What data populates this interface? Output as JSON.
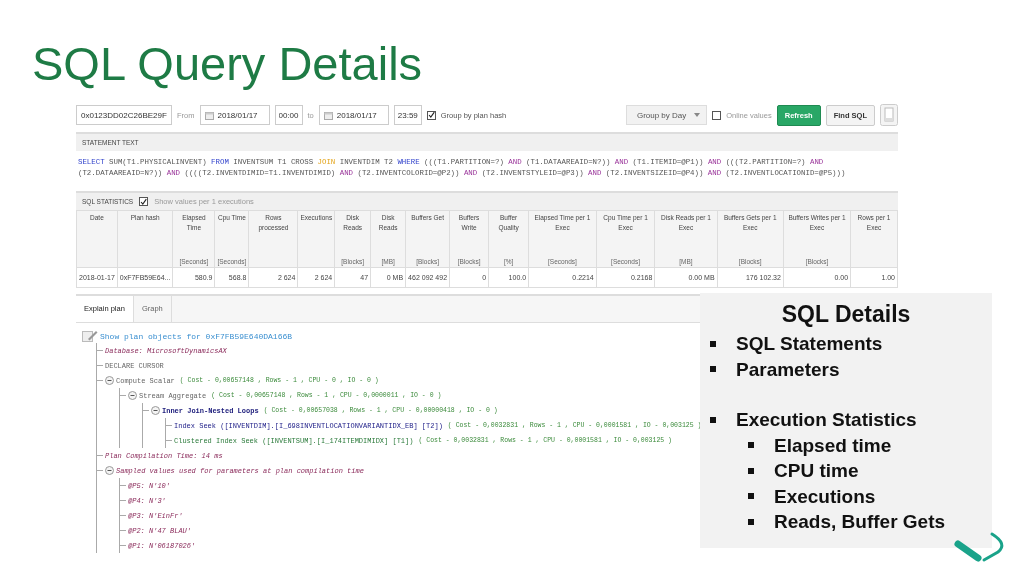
{
  "slide": {
    "title": "SQL Query Details"
  },
  "toolbar": {
    "hash_field": "0x0123DD02C26BE29F",
    "from_label": "From",
    "from_date": "2018/01/17",
    "from_time": "00:00",
    "to_label": "to",
    "to_date": "2018/01/17",
    "to_time": "23:59",
    "group_by_plan_hash": {
      "label": "Group by plan hash",
      "checked": true
    },
    "group_by": "Group by Day",
    "online_values": {
      "label": "Online values",
      "checked": false
    },
    "buttons": [
      {
        "label": "Refresh",
        "kind": "primary"
      },
      {
        "label": "Find SQL",
        "kind": "default"
      }
    ]
  },
  "statement": {
    "header": "STATEMENT TEXT",
    "lines": [
      [
        {
          "kind": "keyword",
          "text": "SELECT"
        },
        {
          "kind": "text",
          "text": "SUM(T1.PHYSICALINVENT)"
        },
        {
          "kind": "keyword",
          "text": "FROM"
        },
        {
          "kind": "text",
          "text": "INVENTSUM T1 CROSS"
        },
        {
          "kind": "join",
          "text": "JOIN"
        },
        {
          "kind": "text",
          "text": "INVENTDIM T2"
        },
        {
          "kind": "keyword",
          "text": "WHERE"
        },
        {
          "kind": "text",
          "text": "(((T1.PARTITION=?)"
        },
        {
          "kind": "logic",
          "text": "AND"
        },
        {
          "kind": "text",
          "text": "(T1.DATAAREAID=N?))"
        },
        {
          "kind": "logic",
          "text": "AND"
        },
        {
          "kind": "text",
          "text": "(T1.ITEMID=@P1))"
        },
        {
          "kind": "logic",
          "text": "AND"
        },
        {
          "kind": "text",
          "text": "(((T2.PARTITION=?)"
        },
        {
          "kind": "logic",
          "text": "AND"
        }
      ],
      [
        {
          "kind": "text",
          "text": "(T2.DATAAREAID=N?))"
        },
        {
          "kind": "logic",
          "text": "AND"
        },
        {
          "kind": "text",
          "text": "((((T2.INVENTDIMID=T1.INVENTDIMID)"
        },
        {
          "kind": "logic",
          "text": "AND"
        },
        {
          "kind": "text",
          "text": "(T2.INVENTCOLORID=@P2))"
        },
        {
          "kind": "logic",
          "text": "AND"
        },
        {
          "kind": "text",
          "text": "(T2.INVENTSTYLEID=@P3))"
        },
        {
          "kind": "logic",
          "text": "AND"
        },
        {
          "kind": "text",
          "text": "(T2.INVENTSIZEID=@P4))"
        },
        {
          "kind": "logic",
          "text": "AND"
        },
        {
          "kind": "text",
          "text": "(T2.INVENTLOCATIONID=@P5)))"
        }
      ]
    ]
  },
  "statistics": {
    "header": "SQL STATISTICS",
    "per_execution": {
      "label": "Show values per 1 executions",
      "checked": true
    },
    "columns": [
      {
        "name": "Date"
      },
      {
        "name": "Plan hash"
      },
      {
        "name": "Elapsed Time",
        "unit": "[Seconds]"
      },
      {
        "name": "Cpu Time",
        "unit": "[Seconds]"
      },
      {
        "name": "Rows processed"
      },
      {
        "name": "Executions"
      },
      {
        "name": "Disk Reads",
        "unit": "[Blocks]"
      },
      {
        "name": "Disk Reads",
        "unit": "[MB]"
      },
      {
        "name": "Buffers Get",
        "unit": "[Blocks]"
      },
      {
        "name": "Buffers Write",
        "unit": "[Blocks]"
      },
      {
        "name": "Buffer Quality",
        "unit": "[%]"
      },
      {
        "name": "Elapsed Time per 1 Exec",
        "unit": "[Seconds]"
      },
      {
        "name": "Cpu Time per 1 Exec",
        "unit": "[Seconds]"
      },
      {
        "name": "Disk Reads per 1 Exec",
        "unit": "[MB]"
      },
      {
        "name": "Buffers Gets per 1 Exec",
        "unit": "[Blocks]"
      },
      {
        "name": "Buffers Writes per 1 Exec",
        "unit": "[Blocks]"
      },
      {
        "name": "Rows per 1 Exec"
      }
    ],
    "rows": [
      [
        "2018-01-17",
        "0xF7FB59E64...",
        "580.9",
        "568.8",
        "2 624",
        "2 624",
        "47",
        "0 MB",
        "462 092 492",
        "0",
        "100.0",
        "0.2214",
        "0.2168",
        "0.00 MB",
        "176 102.32",
        "0.00",
        "1.00"
      ]
    ]
  },
  "tabs": [
    {
      "label": "Explain plan",
      "selected": true
    },
    {
      "label": "Graph",
      "selected": false
    }
  ],
  "plan": {
    "link": "Show plan objects for 0xF7FB59E640DA166B",
    "nodes": [
      {
        "kind": "info",
        "text": "Database: MicrosoftDynamicsAX"
      },
      {
        "kind": "plain",
        "text": "DECLARE CURSOR"
      },
      {
        "kind": "plain",
        "text": "Compute Scalar",
        "detail": "( Cost - 0,00657148 , Rows - 1 , CPU - 0 , IO - 0 )",
        "expanded": true,
        "children": [
          {
            "kind": "plain",
            "text": "Stream Aggregate",
            "detail": "( Cost - 0,00657148 , Rows - 1 , CPU - 0,0000011 , IO - 0 )",
            "expanded": true,
            "children": [
              {
                "kind": "join",
                "text": "Inner Join-Nested Loops",
                "detail": "( Cost - 0,00657038 , Rows - 1 , CPU - 0,00000418 , IO - 0 )",
                "expanded": true,
                "children": [
                  {
                    "kind": "seek",
                    "text": "Index Seek ([INVENTDIM].[I_698INVENTLOCATIONVARIANTIDX_EB] [T2])",
                    "detail": "( Cost - 0,0032831 , Rows - 1 , CPU - 0,0001581 , IO - 0,003125 )"
                  },
                  {
                    "kind": "clustered",
                    "text": "Clustered Index Seek ([INVENTSUM].[I_174ITEMDIMIDX] [T1])",
                    "detail": "( Cost - 0,0032831 , Rows - 1 , CPU - 0,0001581 , IO - 0,003125 )"
                  }
                ]
              }
            ]
          }
        ]
      },
      {
        "kind": "info",
        "text": "Plan Compilation Time: 14 ms"
      },
      {
        "kind": "info",
        "text": "Sampled values used for parameters at plan compilation time",
        "expanded": true,
        "children": [
          {
            "kind": "info",
            "text": "@P5: N'10'"
          },
          {
            "kind": "info",
            "text": "@P4: N'3'"
          },
          {
            "kind": "info",
            "text": "@P3: N'EinFr'"
          },
          {
            "kind": "info",
            "text": "@P2: N'47 BLAU'"
          },
          {
            "kind": "info",
            "text": "@P1: N'06187026'"
          }
        ]
      }
    ]
  },
  "details_box": {
    "title": "SQL Details",
    "items": [
      {
        "text": "SQL Statements"
      },
      {
        "text": "Parameters"
      },
      {
        "text": "Execution Statistics",
        "children": [
          {
            "text": "Elapsed time"
          },
          {
            "text": "CPU time"
          },
          {
            "text": "Executions"
          },
          {
            "text": "Reads, Buffer Gets"
          }
        ]
      }
    ]
  }
}
